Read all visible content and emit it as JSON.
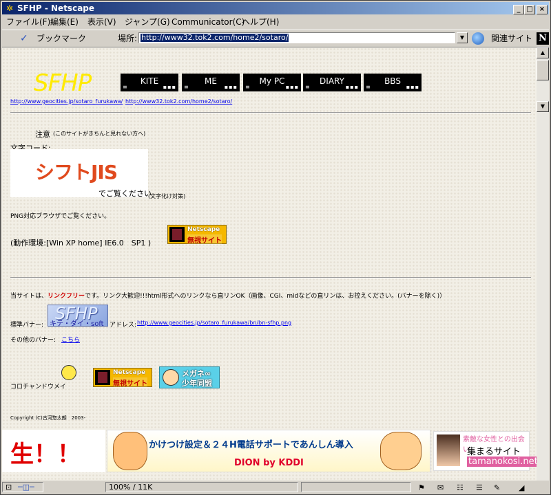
{
  "window": {
    "title": "SFHP - Netscape",
    "controls": {
      "minimize": "_",
      "maximize": "□",
      "close": "×"
    }
  },
  "menu": [
    "ファイル(F)",
    "編集(E)",
    "表示(V)",
    "ジャンプ(G)",
    "Communicator(C)",
    "ヘルプ(H)"
  ],
  "toolbar": {
    "bookmarks_label": "ブックマーク",
    "location_label": "場所:",
    "url": "http://www32.tok2.com/home2/sotaro/",
    "related_label": "関連サイト",
    "brand_letter": "N"
  },
  "page": {
    "logo": "SFHP",
    "nav": [
      "KITE",
      "ME",
      "My PC",
      "DIARY",
      "BBS"
    ],
    "link_geocities": "http://www.geocities.jp/sotaro_furukawa/",
    "link_tok2": "http://www32.tok2.com/home2/sotaro/",
    "notice_title": "注意",
    "notice_sub": "(このサイトがきちんと見れない方へ)",
    "charset_label": "文字コード:",
    "charset_value": "シフトJIS",
    "charset_view": "でご覧ください",
    "charset_note": "(文字化け対策)",
    "png_note": "PNG対応ブラウザでご覧ください。",
    "env_label": "(動作環境:[Win XP home] IE6.0　SP1 )",
    "ns_badge_top": "Netscape",
    "ns_badge_bottom": "無視サイト",
    "link_policy_pre": "当サイトは、",
    "link_policy_bold": "リンクフリー",
    "link_policy_post": "です。リンク大歓迎!!!html形式へのリンクなら直リンOK（画像、CGI、midなどの直リンは、お控えください。(バナーを除く)）",
    "banner_label": "標準バナー:",
    "banner_logo": "SFHP",
    "banner_sub": "キテ・ダイ・soft",
    "banner_addr_label": "アドレス:",
    "banner_url": "http://www.geocities.jp/sotaro_furukawa/bn/bn-sfhp.png",
    "other_banners_label": "その他のバナー:",
    "other_banners_link": "こちら",
    "mascot_label": "コロチャンドウメイ",
    "megane_line1": "メガネ∞",
    "megane_line2": "少年同盟",
    "copyright": "Copyright (C)古河惣太朗　2003-"
  },
  "ads": {
    "left_text": "生！！",
    "mid_line1": "かけつけ設定＆２４H電話サポートであんしん導入",
    "mid_line2": "DION by KDDI",
    "right_line1": "素敵な女性との出会い",
    "right_line2": "集まるサイト",
    "right_line3": "tamanokosi.net"
  },
  "status": {
    "progress": "100% / 11K"
  }
}
